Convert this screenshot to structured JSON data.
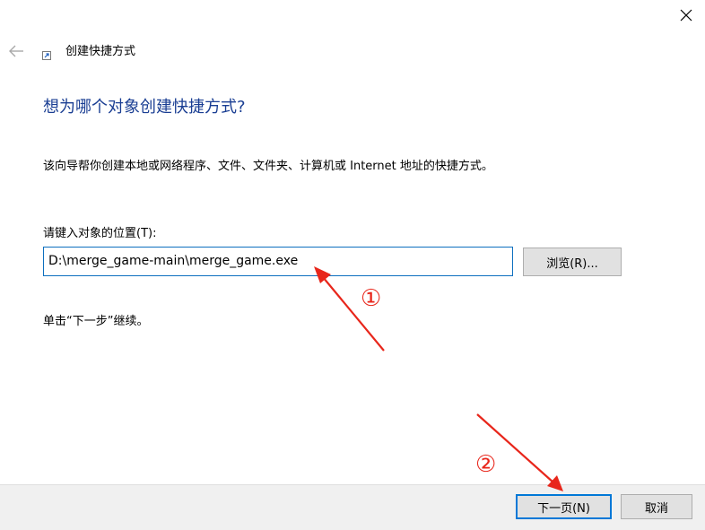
{
  "window": {
    "close_glyph": "✕"
  },
  "header": {
    "back_icon": "back-arrow-icon",
    "shortcut_icon": "shortcut-icon",
    "title": "创建快捷方式"
  },
  "main": {
    "heading": "想为哪个对象创建快捷方式?",
    "description": "该向导帮你创建本地或网络程序、文件、文件夹、计算机或 Internet 地址的快捷方式。",
    "location_label": "请键入对象的位置(T):",
    "location_value": "D:\\merge_game-main\\merge_game.exe",
    "browse_label": "浏览(R)...",
    "continue_hint": "单击“下一步”继续。"
  },
  "footer": {
    "next_label": "下一页(N)",
    "cancel_label": "取消"
  },
  "annotations": {
    "marker_1": "①",
    "marker_2": "②",
    "color": "#e8261b"
  },
  "colors": {
    "heading": "#1a3e93",
    "focus_border": "#0078d7",
    "footer_bg": "#f0f0f0",
    "button_bg": "#e1e1e1"
  }
}
